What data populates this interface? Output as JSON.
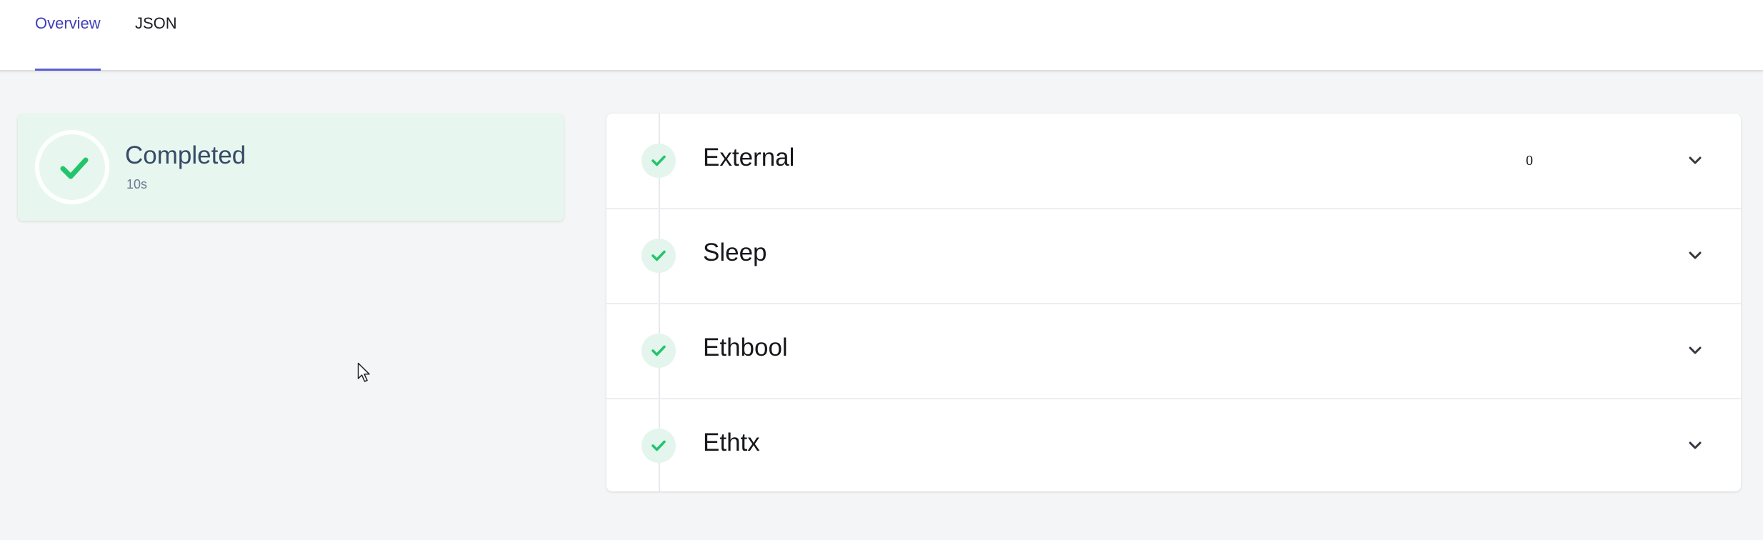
{
  "tabs": [
    {
      "label": "Overview",
      "active": true
    },
    {
      "label": "JSON",
      "active": false
    }
  ],
  "status": {
    "title": "Completed",
    "duration": "10s",
    "icon": "check-icon",
    "color": "#22c56a"
  },
  "steps": [
    {
      "name": "External",
      "value": "0",
      "status": "success"
    },
    {
      "name": "Sleep",
      "value": "",
      "status": "success"
    },
    {
      "name": "Ethbool",
      "value": "",
      "status": "success"
    },
    {
      "name": "Ethtx",
      "value": "",
      "status": "success"
    }
  ],
  "colors": {
    "accent": "#5a5fd3",
    "success": "#22c56a",
    "success_bg": "#e7f7ef",
    "page_bg": "#f4f5f6"
  }
}
